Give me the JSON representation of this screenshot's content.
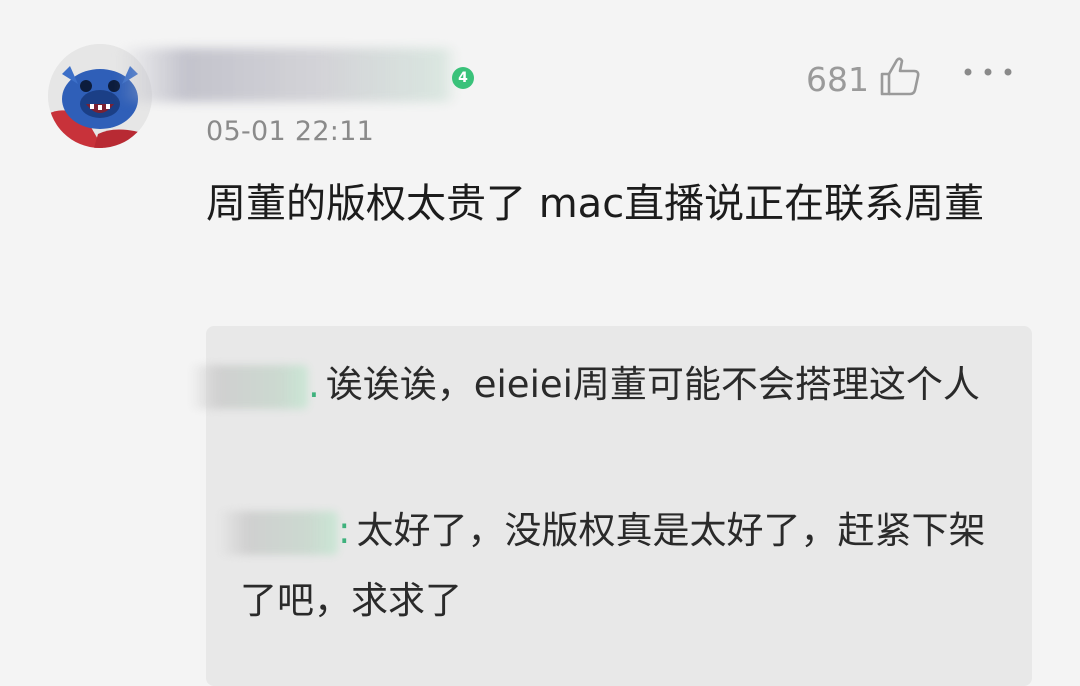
{
  "comment": {
    "username": "",
    "level_badge": "4",
    "timestamp": "05-01 22:11",
    "like_count": "681",
    "text": "周董的版权太贵了 mac直播说正在联系周董"
  },
  "replies": [
    {
      "username": "",
      "separator": ".",
      "text": "诶诶诶，eieiei周董可能不会搭理这个人"
    },
    {
      "username": "",
      "separator": ":",
      "text": "太好了，没版权真是太好了，赶紧下架了吧，求求了"
    }
  ],
  "icons": {
    "like": "thumbs-up-icon",
    "more": "more-dots-icon"
  },
  "colors": {
    "accent_green": "#3ac27a",
    "timestamp_gray": "#8a8a8a",
    "reply_background": "#e8e8e8"
  }
}
